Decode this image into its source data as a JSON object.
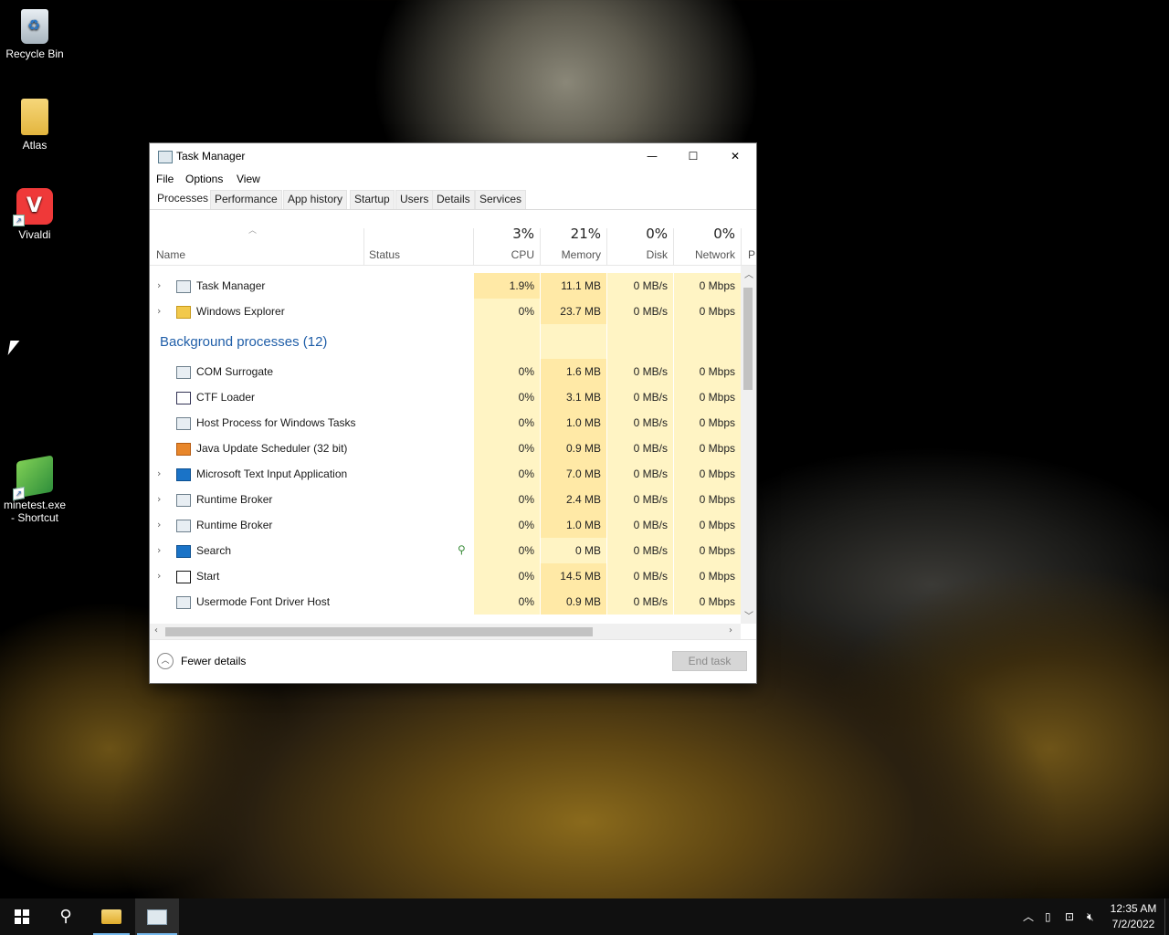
{
  "desktop": {
    "icons": [
      {
        "label": "Recycle Bin"
      },
      {
        "label": "Atlas"
      },
      {
        "label": "Vivaldi"
      },
      {
        "label_line1": "minetest.exe",
        "label_line2": "- Shortcut"
      }
    ]
  },
  "window": {
    "title": "Task Manager",
    "controls": {
      "minimize": "—",
      "maximize": "☐",
      "close": "✕"
    },
    "menu": [
      "File",
      "Options",
      "View"
    ],
    "tabs": [
      "Processes",
      "Performance",
      "App history",
      "Startup",
      "Users",
      "Details",
      "Services"
    ],
    "active_tab": "Processes",
    "columns": {
      "name": "Name",
      "status": "Status",
      "cpu": {
        "pct": "3%",
        "label": "CPU"
      },
      "memory": {
        "pct": "21%",
        "label": "Memory"
      },
      "disk": {
        "pct": "0%",
        "label": "Disk"
      },
      "network": {
        "pct": "0%",
        "label": "Network"
      },
      "power": "P"
    },
    "apps": [
      {
        "name": "Task Manager",
        "cpu": "1.9%",
        "memory": "11.1 MB",
        "disk": "0 MB/s",
        "network": "0 Mbps",
        "expandable": true
      },
      {
        "name": "Windows Explorer",
        "cpu": "0%",
        "memory": "23.7 MB",
        "disk": "0 MB/s",
        "network": "0 Mbps",
        "expandable": true
      }
    ],
    "background_group": "Background processes (12)",
    "background": [
      {
        "name": "COM Surrogate",
        "cpu": "0%",
        "memory": "1.6 MB",
        "disk": "0 MB/s",
        "network": "0 Mbps"
      },
      {
        "name": "CTF Loader",
        "cpu": "0%",
        "memory": "3.1 MB",
        "disk": "0 MB/s",
        "network": "0 Mbps"
      },
      {
        "name": "Host Process for Windows Tasks",
        "cpu": "0%",
        "memory": "1.0 MB",
        "disk": "0 MB/s",
        "network": "0 Mbps"
      },
      {
        "name": "Java Update Scheduler (32 bit)",
        "cpu": "0%",
        "memory": "0.9 MB",
        "disk": "0 MB/s",
        "network": "0 Mbps"
      },
      {
        "name": "Microsoft Text Input Application",
        "cpu": "0%",
        "memory": "7.0 MB",
        "disk": "0 MB/s",
        "network": "0 Mbps"
      },
      {
        "name": "Runtime Broker",
        "cpu": "0%",
        "memory": "2.4 MB",
        "disk": "0 MB/s",
        "network": "0 Mbps"
      },
      {
        "name": "Runtime Broker",
        "cpu": "0%",
        "memory": "1.0 MB",
        "disk": "0 MB/s",
        "network": "0 Mbps"
      },
      {
        "name": "Search",
        "cpu": "0%",
        "memory": "0 MB",
        "disk": "0 MB/s",
        "network": "0 Mbps"
      },
      {
        "name": "Start",
        "cpu": "0%",
        "memory": "14.5 MB",
        "disk": "0 MB/s",
        "network": "0 Mbps"
      },
      {
        "name": "Usermode Font Driver Host",
        "cpu": "0%",
        "memory": "0.9 MB",
        "disk": "0 MB/s",
        "network": "0 Mbps"
      }
    ],
    "footer": {
      "fewer_details": "Fewer details",
      "end_task": "End task"
    }
  },
  "taskbar": {
    "clock_time": "12:35 AM",
    "clock_date": "7/2/2022"
  },
  "colors": {
    "group_header": "#1f5ea8",
    "cpu_heat": "#fff4c4",
    "mem_heat": "#ffe9a6",
    "taskbar_accent": "#76b9ed"
  }
}
